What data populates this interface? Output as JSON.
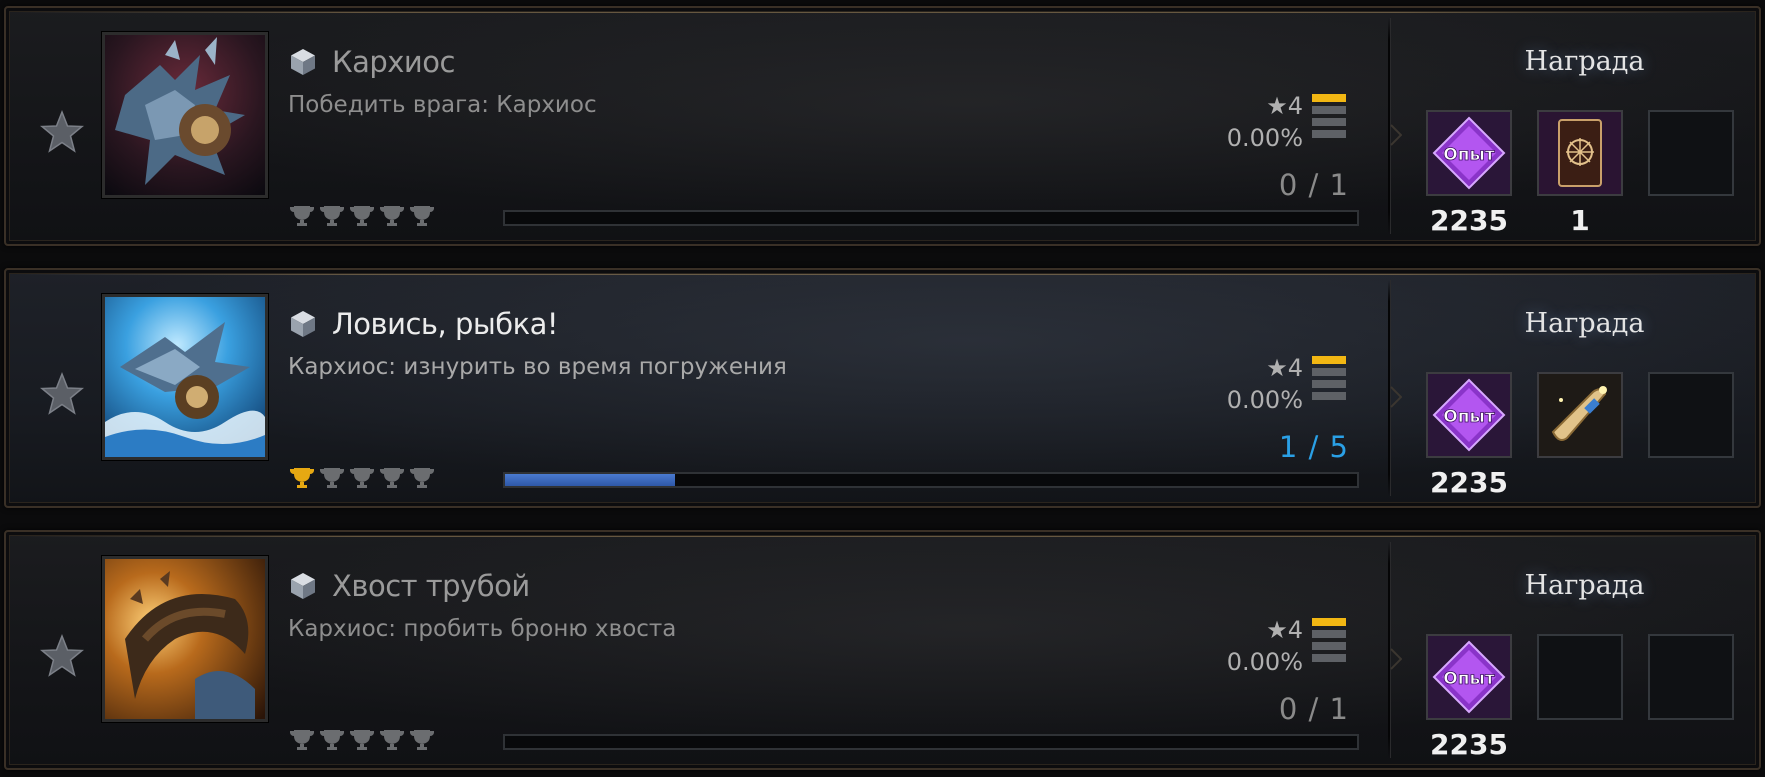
{
  "quests": [
    {
      "title": "Кархиос",
      "description": "Победить врага: Кархиос",
      "grade": "★4",
      "percent": "0.00%",
      "count": "0 / 1",
      "progress": 0.0,
      "trophies_earned": 0,
      "trophies_total": 5,
      "tier_bars_on": 1,
      "tier_bars_total": 4,
      "active": false,
      "portrait_icon": "karhios-dragon-portrait",
      "reward_label": "Награда",
      "rewards": [
        {
          "icon": "experience-crystal-icon",
          "text": "Опыт",
          "count": "2235"
        },
        {
          "icon": "card-pack-icon",
          "count": "1"
        },
        {
          "icon": "empty-slot"
        }
      ]
    },
    {
      "title": "Ловись, рыбка!",
      "description": "Кархиос: изнурить во время погружения",
      "grade": "★4",
      "percent": "0.00%",
      "count": "1 / 5",
      "progress": 0.2,
      "trophies_earned": 1,
      "trophies_total": 5,
      "tier_bars_on": 1,
      "tier_bars_total": 4,
      "active": true,
      "portrait_icon": "karhios-water-portrait",
      "reward_label": "Награда",
      "rewards": [
        {
          "icon": "experience-crystal-icon",
          "text": "Опыт",
          "count": "2235"
        },
        {
          "icon": "scroll-icon"
        },
        {
          "icon": "empty-slot"
        }
      ]
    },
    {
      "title": "Хвост трубой",
      "description": "Кархиос: пробить броню хвоста",
      "grade": "★4",
      "percent": "0.00%",
      "count": "0 / 1",
      "progress": 0.0,
      "trophies_earned": 0,
      "trophies_total": 5,
      "tier_bars_on": 1,
      "tier_bars_total": 4,
      "active": false,
      "portrait_icon": "karhios-tail-portrait",
      "reward_label": "Награда",
      "rewards": [
        {
          "icon": "experience-crystal-icon",
          "text": "Опыт",
          "count": "2235"
        },
        {
          "icon": "empty-slot"
        },
        {
          "icon": "empty-slot"
        }
      ]
    }
  ],
  "colors": {
    "gold": "#f2b713",
    "progress_blue": "#2e58a8",
    "count_active": "#2aa0e6",
    "exp_purple": "#9a3fd8"
  }
}
